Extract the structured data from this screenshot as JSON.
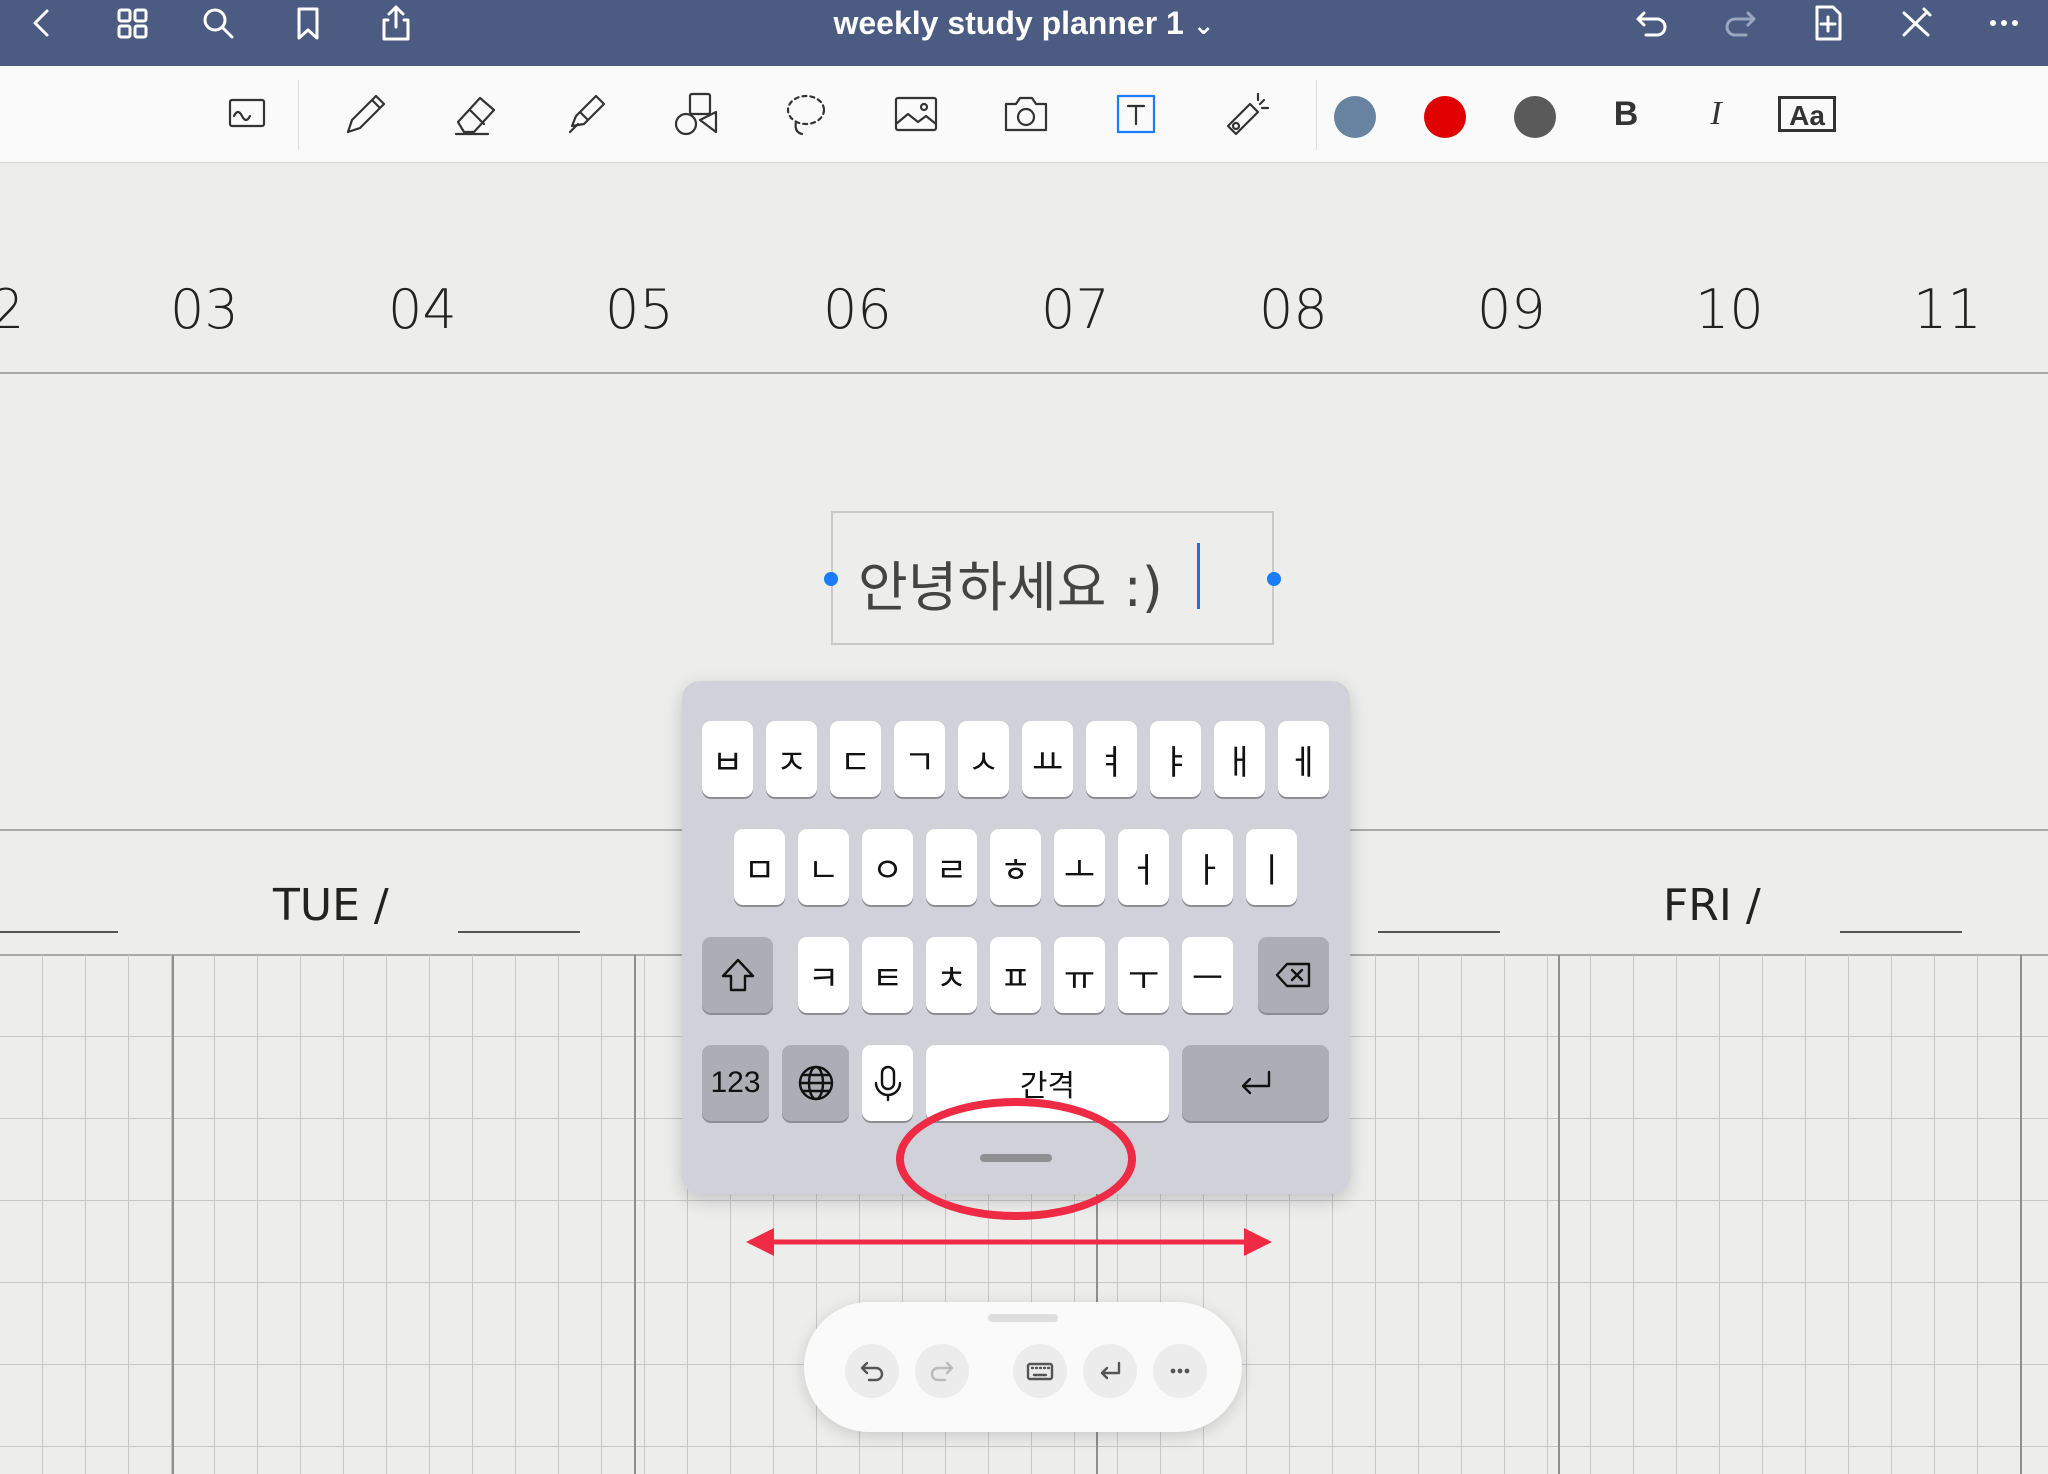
{
  "document": {
    "title": "weekly study planner 1",
    "title_chevron": "⌄"
  },
  "colors": {
    "titlebar": "#4b5b82",
    "swatch_blue_grey": "#6783a0",
    "swatch_red": "#e00000",
    "swatch_dark_grey": "#5a5a5a",
    "annotation_red": "#ee2a44",
    "selection_blue": "#1a7cf6"
  },
  "toolbar": {
    "bold_label": "B",
    "italic_label": "I",
    "font_label": "Aa"
  },
  "planner": {
    "hours": [
      "2",
      "03",
      "04",
      "05",
      "06",
      "07",
      "08",
      "09",
      "10",
      "11"
    ],
    "days": [
      "TUE /",
      "FRI /"
    ]
  },
  "textbox": {
    "text": "안녕하세요 :)"
  },
  "keyboard": {
    "row1": [
      "ㅂ",
      "ㅈ",
      "ㄷ",
      "ㄱ",
      "ㅅ",
      "ㅛ",
      "ㅕ",
      "ㅑ",
      "ㅐ",
      "ㅔ"
    ],
    "row2": [
      "ㅁ",
      "ㄴ",
      "ㅇ",
      "ㄹ",
      "ㅎ",
      "ㅗ",
      "ㅓ",
      "ㅏ",
      "ㅣ"
    ],
    "row3": [
      "ㅋ",
      "ㅌ",
      "ㅊ",
      "ㅍ",
      "ㅠ",
      "ㅜ",
      "ㅡ"
    ],
    "numbers_label": "123",
    "space_label": "간격"
  }
}
